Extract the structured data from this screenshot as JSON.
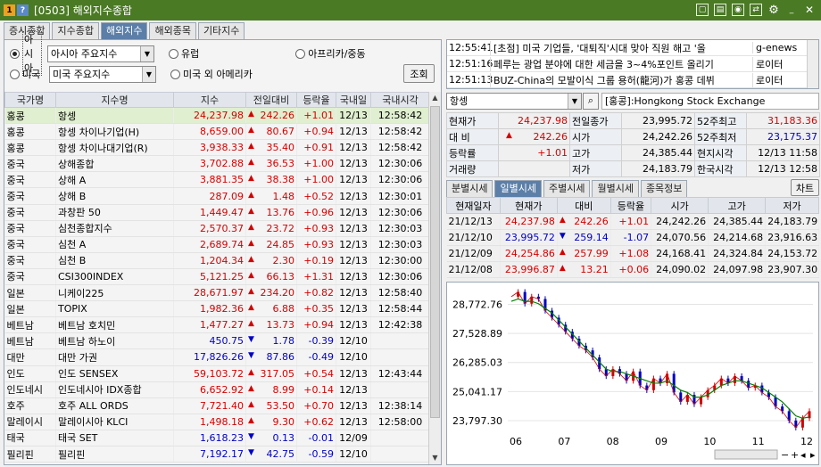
{
  "window": {
    "badge1": "1",
    "badge2": "?",
    "title": "[0503] 해외지수종합",
    "icons": [
      "new-window-icon",
      "save-icon",
      "capture-icon",
      "link-icon",
      "gear-icon",
      "minimize-icon",
      "close-icon"
    ],
    "color_bar": "#4a7a24"
  },
  "tabs": [
    {
      "label": "증시종합",
      "active": false
    },
    {
      "label": "지수종합",
      "active": false
    },
    {
      "label": "해외지수",
      "active": true
    },
    {
      "label": "해외종목",
      "active": false
    },
    {
      "label": "기타지수",
      "active": false
    }
  ],
  "filters": {
    "asia_radio": "아시아",
    "asia_combo": "아시아 주요지수",
    "us_radio": "미국",
    "us_combo": "미국 주요지수",
    "europe": "유럽",
    "americas": "미국 외 아메리카",
    "africa": "아프리카/중동",
    "search_button": "조회"
  },
  "grid": {
    "headers": [
      "국가명",
      "지수명",
      "지수",
      "전일대비",
      "등락율",
      "국내일",
      "국내시각"
    ],
    "rows": [
      {
        "country": "홍콩",
        "name": "항셍",
        "value": "24,237.98",
        "dir": "up",
        "chg": "242.26",
        "rate": "+1.01",
        "date": "12/13",
        "time": "12:58:42",
        "sel": true
      },
      {
        "country": "홍콩",
        "name": "항셍 차이나기업(H)",
        "value": "8,659.00",
        "dir": "up",
        "chg": "80.67",
        "rate": "+0.94",
        "date": "12/13",
        "time": "12:58:42"
      },
      {
        "country": "홍콩",
        "name": "항셍 차이나대기업(R)",
        "value": "3,938.33",
        "dir": "up",
        "chg": "35.40",
        "rate": "+0.91",
        "date": "12/13",
        "time": "12:58:42"
      },
      {
        "country": "중국",
        "name": "상해종합",
        "value": "3,702.88",
        "dir": "up",
        "chg": "36.53",
        "rate": "+1.00",
        "date": "12/13",
        "time": "12:30:06"
      },
      {
        "country": "중국",
        "name": "상해 A",
        "value": "3,881.35",
        "dir": "up",
        "chg": "38.38",
        "rate": "+1.00",
        "date": "12/13",
        "time": "12:30:06"
      },
      {
        "country": "중국",
        "name": "상해 B",
        "value": "287.09",
        "dir": "up",
        "chg": "1.48",
        "rate": "+0.52",
        "date": "12/13",
        "time": "12:30:01"
      },
      {
        "country": "중국",
        "name": "과창판 50",
        "value": "1,449.47",
        "dir": "up",
        "chg": "13.76",
        "rate": "+0.96",
        "date": "12/13",
        "time": "12:30:06"
      },
      {
        "country": "중국",
        "name": "심천종합지수",
        "value": "2,570.37",
        "dir": "up",
        "chg": "23.72",
        "rate": "+0.93",
        "date": "12/13",
        "time": "12:30:03"
      },
      {
        "country": "중국",
        "name": "심천 A",
        "value": "2,689.74",
        "dir": "up",
        "chg": "24.85",
        "rate": "+0.93",
        "date": "12/13",
        "time": "12:30:03"
      },
      {
        "country": "중국",
        "name": "심천 B",
        "value": "1,204.34",
        "dir": "up",
        "chg": "2.30",
        "rate": "+0.19",
        "date": "12/13",
        "time": "12:30:00"
      },
      {
        "country": "중국",
        "name": "CSI300INDEX",
        "value": "5,121.25",
        "dir": "up",
        "chg": "66.13",
        "rate": "+1.31",
        "date": "12/13",
        "time": "12:30:06"
      },
      {
        "country": "일본",
        "name": "니케이225",
        "value": "28,671.97",
        "dir": "up",
        "chg": "234.20",
        "rate": "+0.82",
        "date": "12/13",
        "time": "12:58:40"
      },
      {
        "country": "일본",
        "name": "TOPIX",
        "value": "1,982.36",
        "dir": "up",
        "chg": "6.88",
        "rate": "+0.35",
        "date": "12/13",
        "time": "12:58:44"
      },
      {
        "country": "베트남",
        "name": "베트남 호치민",
        "value": "1,477.27",
        "dir": "up",
        "chg": "13.73",
        "rate": "+0.94",
        "date": "12/13",
        "time": "12:42:38"
      },
      {
        "country": "베트남",
        "name": "베트남 하노이",
        "value": "450.75",
        "dir": "dn",
        "chg": "1.78",
        "rate": "-0.39",
        "date": "12/10",
        "time": ""
      },
      {
        "country": "대만",
        "name": "대만 가권",
        "value": "17,826.26",
        "dir": "dn",
        "chg": "87.86",
        "rate": "-0.49",
        "date": "12/10",
        "time": ""
      },
      {
        "country": "인도",
        "name": "인도 SENSEX",
        "value": "59,103.72",
        "dir": "up",
        "chg": "317.05",
        "rate": "+0.54",
        "date": "12/13",
        "time": "12:43:44"
      },
      {
        "country": "인도네시",
        "name": "인도네시아 IDX종합",
        "value": "6,652.92",
        "dir": "up",
        "chg": "8.99",
        "rate": "+0.14",
        "date": "12/13",
        "time": ""
      },
      {
        "country": "호주",
        "name": "호주 ALL ORDS",
        "value": "7,721.40",
        "dir": "up",
        "chg": "53.50",
        "rate": "+0.70",
        "date": "12/13",
        "time": "12:38:14"
      },
      {
        "country": "말레이시",
        "name": "말레이시아 KLCI",
        "value": "1,498.18",
        "dir": "up",
        "chg": "9.30",
        "rate": "+0.62",
        "date": "12/13",
        "time": "12:58:00"
      },
      {
        "country": "태국",
        "name": "태국 SET",
        "value": "1,618.23",
        "dir": "dn",
        "chg": "0.13",
        "rate": "-0.01",
        "date": "12/09",
        "time": ""
      },
      {
        "country": "필리핀",
        "name": "필리핀",
        "value": "7,192.17",
        "dir": "dn",
        "chg": "42.75",
        "rate": "-0.59",
        "date": "12/10",
        "time": ""
      }
    ]
  },
  "news": [
    {
      "time": "12:55:41",
      "headline": "[초점] 미국 기업들, '대퇴직'시대 맞아 직원 해고 '올",
      "source": "g-enews"
    },
    {
      "time": "12:51:16",
      "headline": "페루는 광업 분야에 대한 세금을 3~4%포인트 올리기",
      "source": "로이터"
    },
    {
      "time": "12:51:13",
      "headline": "BUZ-China의 모발이식 그룹 용허(龍河)가 홍콩 데뷔",
      "source": "로이터"
    }
  ],
  "search": {
    "value": "항셍",
    "exchange": "[홍콩]:Hongkong Stock Exchange"
  },
  "quote": {
    "현재가": "24,237.98",
    "대비_dir": "up",
    "대비": "242.26",
    "등락률": "+1.01",
    "거래량": "",
    "전일종가": "23,995.72",
    "시가": "24,242.26",
    "고가": "24,385.44",
    "저가": "24,183.79",
    "52주최고": "31,183.36",
    "52주최저": "23,175.37",
    "현지시각": "12/13 11:58",
    "한국시각": "12/13 12:58",
    "labels": [
      "현재가",
      "대 비",
      "등락률",
      "거래량",
      "전일종가",
      "시가",
      "고가",
      "저가",
      "52주최고",
      "52주최저",
      "현지시각",
      "한국시각"
    ]
  },
  "subtabs": [
    {
      "label": "분별시세",
      "active": false
    },
    {
      "label": "일별시세",
      "active": true
    },
    {
      "label": "주별시세",
      "active": false
    },
    {
      "label": "월별시세",
      "active": false
    },
    {
      "label": "종목정보",
      "active": false
    }
  ],
  "chart_button": "차트",
  "daily": {
    "headers": [
      "현재일자",
      "현재가",
      "대비",
      "등락율",
      "시가",
      "고가",
      "저가"
    ],
    "rows": [
      {
        "date": "21/12/13",
        "close": "24,237.98",
        "close_dir": "up",
        "dir": "up",
        "chg": "242.26",
        "rate": "+1.01",
        "open": "24,242.26",
        "high": "24,385.44",
        "low": "24,183.79"
      },
      {
        "date": "21/12/10",
        "close": "23,995.72",
        "close_dir": "dn",
        "dir": "dn",
        "chg": "259.14",
        "rate": "-1.07",
        "open": "24,070.56",
        "high": "24,214.68",
        "low": "23,916.63"
      },
      {
        "date": "21/12/09",
        "close": "24,254.86",
        "close_dir": "up",
        "dir": "up",
        "chg": "257.99",
        "rate": "+1.08",
        "open": "24,168.41",
        "high": "24,324.84",
        "low": "24,153.72"
      },
      {
        "date": "21/12/08",
        "close": "23,996.87",
        "close_dir": "up",
        "dir": "up",
        "chg": "13.21",
        "rate": "+0.06",
        "open": "24,090.02",
        "high": "24,097.98",
        "low": "23,907.30"
      }
    ]
  },
  "chart_data": {
    "type": "line",
    "title": "",
    "x": [
      "06",
      "07",
      "08",
      "09",
      "10",
      "11",
      "12"
    ],
    "yticks": [
      "28,772.76",
      "27,528.89",
      "26,285.03",
      "25,041.17",
      "23,797.30"
    ],
    "ylim": [
      23300,
      29400
    ],
    "series": [
      {
        "name": "",
        "color": "#d00000",
        "values": [
          29100,
          29300,
          28800,
          29100,
          29000,
          28500,
          28200,
          27900,
          27600,
          27300,
          27000,
          26800,
          26500,
          26000,
          25700,
          26000,
          25800,
          25500,
          25900,
          25300,
          25100,
          25600,
          25400,
          25800,
          25000,
          24600,
          24900,
          24500,
          24800,
          25100,
          25300,
          25600,
          25400,
          25700,
          25500,
          25200,
          25300,
          25000,
          24800,
          24400,
          24200,
          23800,
          23500,
          23900,
          24200
        ]
      },
      {
        "name": "",
        "color": "#008000",
        "values": [
          28900,
          29000,
          28900,
          28900,
          28800,
          28600,
          28400,
          28100,
          27800,
          27500,
          27200,
          26900,
          26600,
          26300,
          26000,
          25900,
          25900,
          25800,
          25700,
          25600,
          25500,
          25400,
          25400,
          25500,
          25300,
          25100,
          25000,
          24800,
          24800,
          24900,
          25100,
          25300,
          25400,
          25500,
          25500,
          25400,
          25300,
          25200,
          25000,
          24800,
          24600,
          24300,
          24000,
          23900,
          23950
        ]
      }
    ]
  },
  "zoom_controls": [
    "zoom-out-icon",
    "zoom-in-icon",
    "scroll-left-icon",
    "scroll-right-icon"
  ]
}
